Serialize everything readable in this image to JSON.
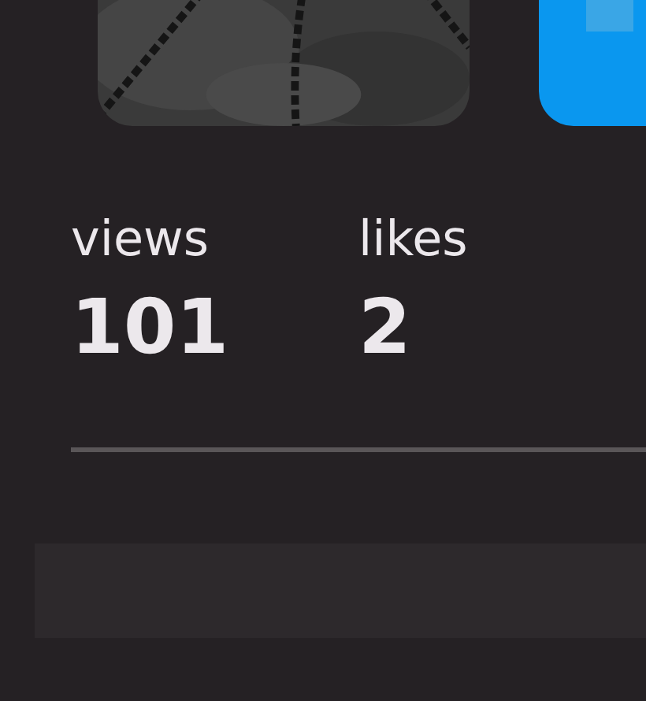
{
  "stats": [
    {
      "label": "views",
      "value": "101"
    },
    {
      "label": "likes",
      "value": "2"
    }
  ]
}
